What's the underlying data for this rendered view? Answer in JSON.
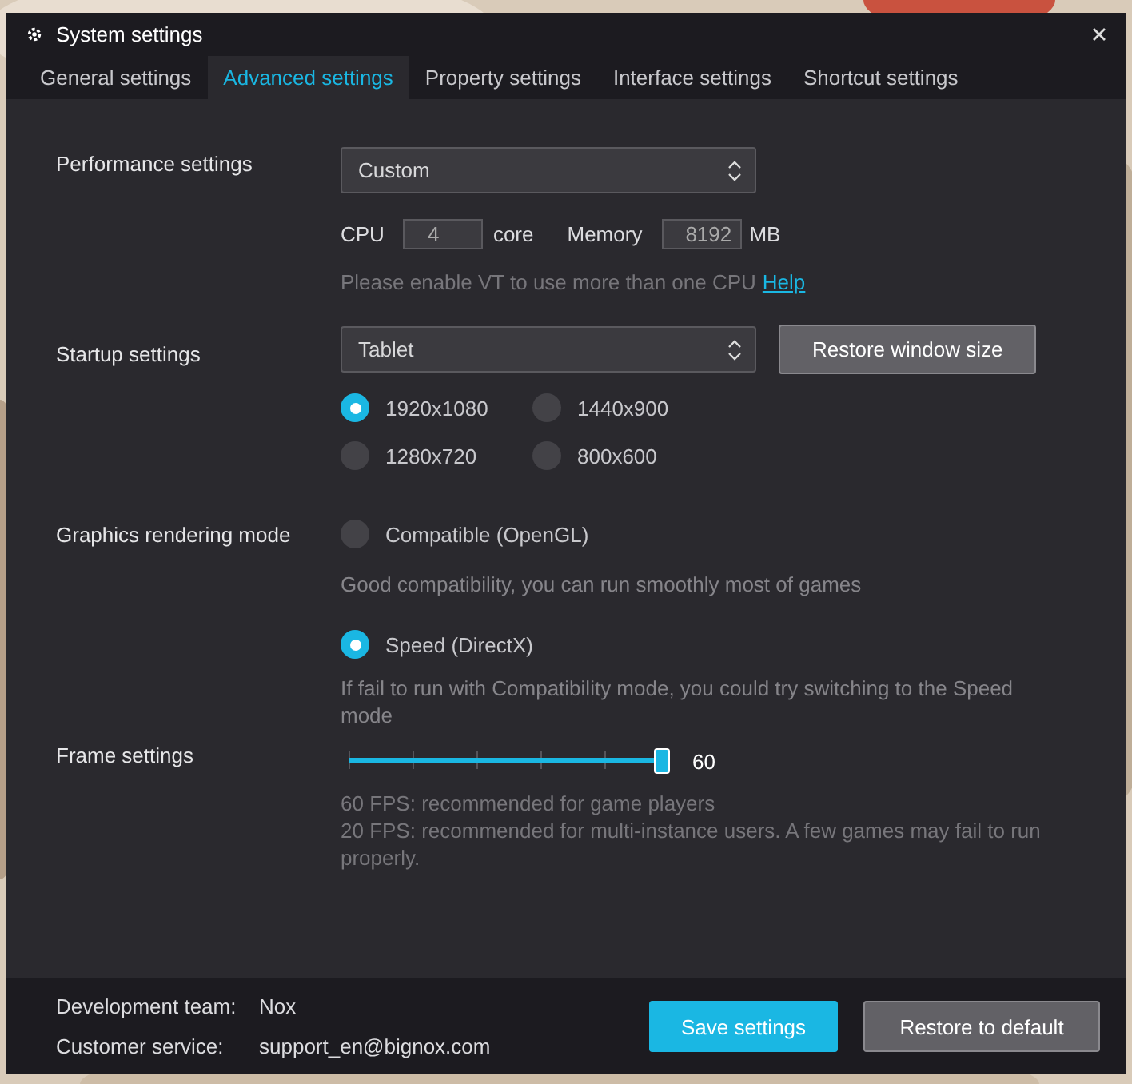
{
  "window": {
    "title": "System settings"
  },
  "tabs": [
    {
      "label": "General settings",
      "selected": false
    },
    {
      "label": "Advanced settings",
      "selected": true
    },
    {
      "label": "Property settings",
      "selected": false
    },
    {
      "label": "Interface settings",
      "selected": false
    },
    {
      "label": "Shortcut settings",
      "selected": false
    }
  ],
  "performance": {
    "label": "Performance settings",
    "mode": "Custom",
    "cpu_label": "CPU",
    "cpu_value": "4",
    "cpu_unit": "core",
    "memory_label": "Memory",
    "memory_value": "8192",
    "memory_unit": "MB",
    "hint": "Please enable VT to use more than one CPU",
    "help_link": "Help"
  },
  "startup": {
    "label": "Startup settings",
    "mode": "Tablet",
    "restore_button": "Restore window size",
    "resolutions": [
      {
        "label": "1920x1080",
        "selected": true
      },
      {
        "label": "1440x900",
        "selected": false
      },
      {
        "label": "1280x720",
        "selected": false
      },
      {
        "label": "800x600",
        "selected": false
      }
    ]
  },
  "graphics": {
    "label": "Graphics rendering mode",
    "options": [
      {
        "label": "Compatible (OpenGL)",
        "selected": false,
        "description": "Good compatibility, you can run smoothly most of games"
      },
      {
        "label": "Speed (DirectX)",
        "selected": true,
        "description": "If fail to run with Compatibility mode, you could try switching to the Speed mode"
      }
    ]
  },
  "frame": {
    "label": "Frame settings",
    "level": 1,
    "reading": "60",
    "notes": [
      "60 FPS: recommended for game players",
      "20 FPS: recommended for multi-instance users. A few games may fail to run properly."
    ]
  },
  "footer": {
    "dev_label": "Development team:",
    "dev_value": "Nox",
    "service_label": "Customer service:",
    "service_value": "support_en@bignox.com",
    "save_button": "Save settings",
    "default_button": "Restore to default"
  }
}
